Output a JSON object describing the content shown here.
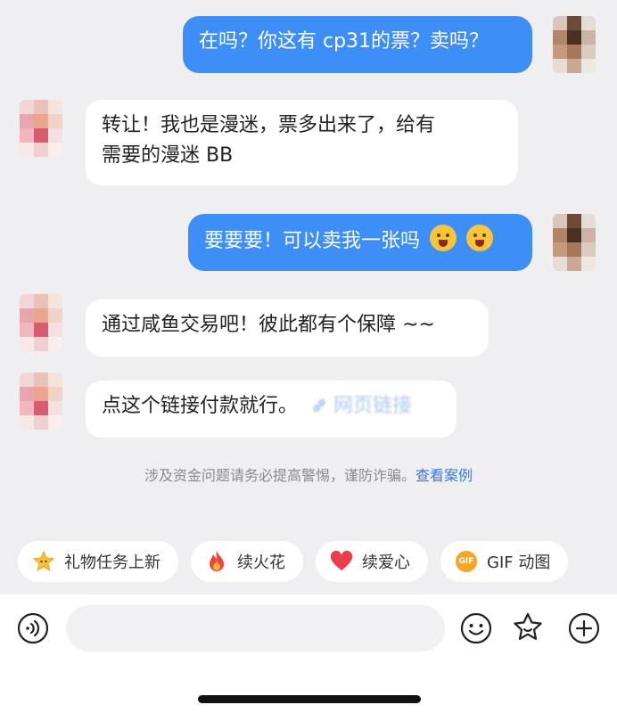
{
  "messages": [
    {
      "side": "out",
      "text": "在吗？你这有 cp31的票？卖吗？"
    },
    {
      "side": "in",
      "line1": "转让！我也是漫迷，票多出来了，给有",
      "line2": "需要的漫迷 BB"
    },
    {
      "side": "out",
      "text": "要要要！可以卖我一张吗"
    },
    {
      "side": "in",
      "text": "通过咸鱼交易吧！彼此都有个保障 ~~"
    },
    {
      "side": "in",
      "text": "点这个链接付款就行。",
      "link_text": "网页链接"
    }
  ],
  "notice": {
    "text": "涉及资金问题请务必提高警惕，谨防诈骗。",
    "link": "查看案例"
  },
  "chips": [
    {
      "label": "礼物任务上新",
      "icon": "star-icon"
    },
    {
      "label": "续火花",
      "icon": "fire-icon"
    },
    {
      "label": "续爱心",
      "icon": "heart-icon"
    },
    {
      "label": "GIF 动图",
      "icon": "gif-icon",
      "badge": "GIF"
    }
  ],
  "input": {
    "placeholder": ""
  },
  "colors": {
    "outgoing_bubble": "#3e8ef7",
    "incoming_bubble": "#ffffff",
    "background": "#efeff1",
    "link": "#3a78d9"
  }
}
